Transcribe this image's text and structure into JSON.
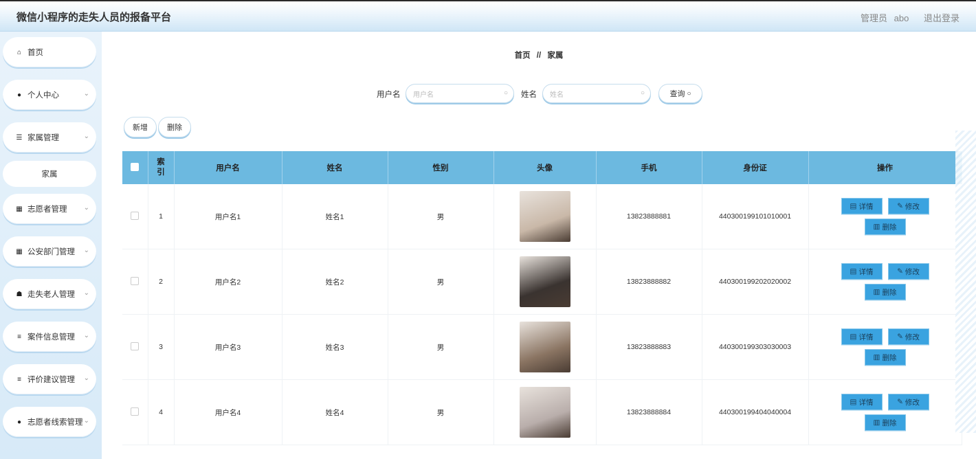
{
  "header": {
    "title": "微信小程序的走失人员的报备平台",
    "role": "管理员",
    "username": "abo",
    "logout": "退出登录"
  },
  "sidebar": {
    "items": [
      {
        "label": "首页",
        "icon": "home-icon",
        "glyph": "⌂",
        "expandable": false
      },
      {
        "label": "个人中心",
        "icon": "user-icon",
        "glyph": "●",
        "expandable": true
      },
      {
        "label": "家属管理",
        "icon": "sliders-icon",
        "glyph": "☰",
        "expandable": true
      },
      {
        "label": "家属",
        "icon": "",
        "glyph": "",
        "expandable": false,
        "sub": true
      },
      {
        "label": "志愿者管理",
        "icon": "grid-icon",
        "glyph": "▦",
        "expandable": true
      },
      {
        "label": "公安部门管理",
        "icon": "grid-icon",
        "glyph": "▦",
        "expandable": true
      },
      {
        "label": "走失老人管理",
        "icon": "thumb-icon",
        "glyph": "☗",
        "expandable": true
      },
      {
        "label": "案件信息管理",
        "icon": "list-icon",
        "glyph": "≡",
        "expandable": true
      },
      {
        "label": "评价建议管理",
        "icon": "list-icon",
        "glyph": "≡",
        "expandable": true
      },
      {
        "label": "志愿者线索管理",
        "icon": "bulb-icon",
        "glyph": "●",
        "expandable": true
      }
    ]
  },
  "breadcrumb": {
    "home": "首页",
    "sep": "//",
    "current": "家属"
  },
  "search": {
    "username_label": "用户名",
    "username_placeholder": "用户名",
    "username_value": "",
    "name_label": "姓名",
    "name_placeholder": "姓名",
    "name_value": "",
    "query_label": "查询"
  },
  "actions": {
    "add": "新增",
    "delete": "删除"
  },
  "table": {
    "columns": [
      "",
      "索引",
      "用户名",
      "姓名",
      "性别",
      "头像",
      "手机",
      "身份证",
      "操作"
    ],
    "rows": [
      {
        "index": "1",
        "username": "用户名1",
        "name": "姓名1",
        "gender": "男",
        "phone": "13823888881",
        "id_card": "440300199101010001"
      },
      {
        "index": "2",
        "username": "用户名2",
        "name": "姓名2",
        "gender": "男",
        "phone": "13823888882",
        "id_card": "440300199202020002"
      },
      {
        "index": "3",
        "username": "用户名3",
        "name": "姓名3",
        "gender": "男",
        "phone": "13823888883",
        "id_card": "440300199303030003"
      },
      {
        "index": "4",
        "username": "用户名4",
        "name": "姓名4",
        "gender": "男",
        "phone": "13823888884",
        "id_card": "440300199404040004"
      }
    ],
    "ops": {
      "detail": "详情",
      "edit": "修改",
      "delete": "删除"
    },
    "avatar_colors": [
      "#c9b8a8",
      "#3a3330",
      "#8a7462",
      "#b9aeab"
    ]
  },
  "colors": {
    "accent": "#3aa3e0",
    "header_row": "#6cb9e0",
    "sidebar_bg": "#d7eaf8"
  }
}
